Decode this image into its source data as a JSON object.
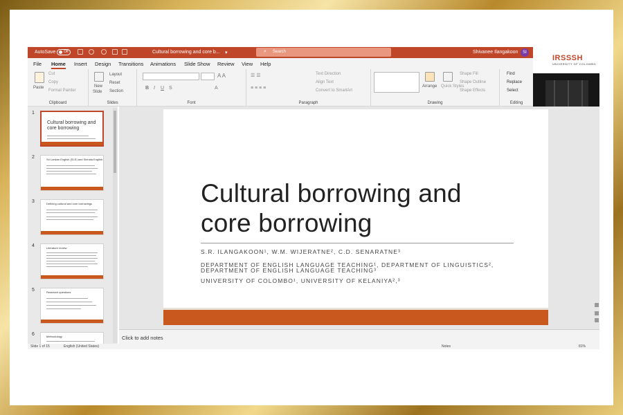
{
  "titlebar": {
    "autosave_label": "AutoSave",
    "autosave_state": "Off",
    "document_title": "Cultural borrowing and core b...",
    "search_placeholder": "Search",
    "user_name": "Shivanee Ilangakoon",
    "user_initial": "SI"
  },
  "menu": {
    "tabs": [
      "File",
      "Home",
      "Insert",
      "Design",
      "Transitions",
      "Animations",
      "Slide Show",
      "Review",
      "View",
      "Help"
    ],
    "active": "Home"
  },
  "ribbon": {
    "clipboard": {
      "paste": "Paste",
      "cut": "Cut",
      "copy": "Copy",
      "format_painter": "Format Painter",
      "label": "Clipboard"
    },
    "slides": {
      "new_slide": "New",
      "new_slide_2": "Slide",
      "layout": "Layout",
      "reset": "Reset",
      "section": "Section",
      "label": "Slides"
    },
    "font": {
      "label": "Font"
    },
    "paragraph": {
      "text_direction": "Text Direction",
      "align_text": "Align Text",
      "smartart": "Convert to SmartArt",
      "label": "Paragraph"
    },
    "drawing": {
      "arrange": "Arrange",
      "quick_styles": "Quick Styles",
      "shape_fill": "Shape Fill",
      "shape_outline": "Shape Outline",
      "shape_effects": "Shape Effects",
      "label": "Drawing"
    },
    "editing": {
      "find": "Find",
      "replace": "Replace",
      "select": "Select",
      "label": "Editing"
    }
  },
  "video": {
    "logo": "IRSSSH",
    "logo_sub": "UNIVERSITY OF COLOMBO"
  },
  "thumbnails": [
    {
      "num": "1",
      "title": "Cultural borrowing and core borrowing",
      "selected": true
    },
    {
      "num": "2",
      "title": "Sri Lankan English (SLE) and Sinhala English",
      "selected": false
    },
    {
      "num": "3",
      "title": "Defining cultural and core borrowings",
      "selected": false
    },
    {
      "num": "4",
      "title": "Literature review",
      "selected": false
    },
    {
      "num": "5",
      "title": "Research questions",
      "selected": false
    },
    {
      "num": "6",
      "title": "Methodology",
      "selected": false
    }
  ],
  "slide": {
    "title_line1": "Cultural borrowing and",
    "title_line2": "core borrowing",
    "authors": "S.R. ILANGAKOON¹, W.M. WIJERATNE², C.D. SENARATNE³",
    "dept_line1": "DEPARTMENT OF ENGLISH LANGUAGE TEACHING¹, DEPARTMENT OF LINGUISTICS²,",
    "dept_line2": "DEPARTMENT OF ENGLISH LANGUAGE TEACHING³",
    "universities": "UNIVERSITY OF COLOMBO¹, UNIVERSITY OF KELANIYA²,³"
  },
  "notes": {
    "placeholder": "Click to add notes"
  },
  "status": {
    "slide_count": "Slide 1 of 15",
    "language": "English (United States)",
    "notes": "Notes",
    "zoom": "81%"
  },
  "colors": {
    "accent": "#c0462a",
    "slide_bar": "#c9581e",
    "gold_frame": "#d9b45a"
  }
}
